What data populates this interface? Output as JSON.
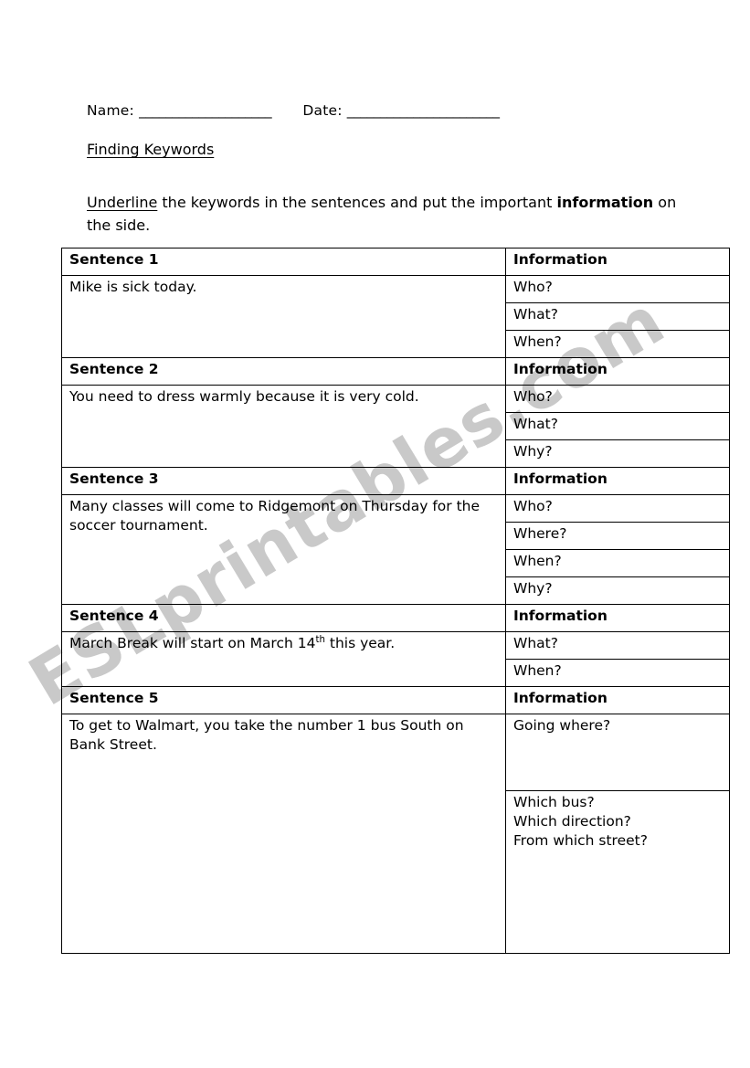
{
  "header": {
    "name_label": "Name:",
    "name_blank": "____________________",
    "date_label": "Date:",
    "date_blank": "_______________________"
  },
  "title": "Finding Keywords",
  "instructions": {
    "underlined_word": "Underline",
    "middle": " the keywords in the sentences and put the important ",
    "bold_word": "information",
    "tail": " on the side."
  },
  "table": {
    "sentence_header_prefix": "Sentence",
    "info_header": "Information",
    "sections": [
      {
        "heading": "Sentence 1",
        "info_heading": "Information",
        "sentence": "Mike is sick today.",
        "questions": [
          "Who?",
          "What?",
          "When?"
        ]
      },
      {
        "heading": "Sentence 2",
        "info_heading": "Information",
        "sentence": "You need to dress warmly because it is very cold.",
        "questions": [
          "Who?",
          "What?",
          "Why?"
        ]
      },
      {
        "heading": "Sentence 3",
        "info_heading": "Information",
        "sentence": "Many classes will come to Ridgemont on Thursday for the soccer tournament.",
        "questions": [
          "Who?",
          "Where?",
          "When?",
          "Why?"
        ]
      },
      {
        "heading": "Sentence 4",
        "info_heading": "Information",
        "sentence_part1": "March Break will start on March 14",
        "sentence_sup": "th",
        "sentence_part2": " this year.",
        "questions": [
          "What?",
          "When?"
        ]
      },
      {
        "heading": "Sentence 5",
        "info_heading": "Information",
        "sentence": "To get to Walmart, you take the number 1 bus South on Bank Street.",
        "questions_first": "Going where?",
        "questions_grouped": [
          "Which bus?",
          "Which direction?",
          "From which street?"
        ]
      }
    ]
  },
  "watermark": {
    "text": "ESLprintables.com",
    "color": "#c9c9c9"
  },
  "colors": {
    "page_background": "#ffffff",
    "text": "#000000",
    "table_border": "#000000"
  }
}
